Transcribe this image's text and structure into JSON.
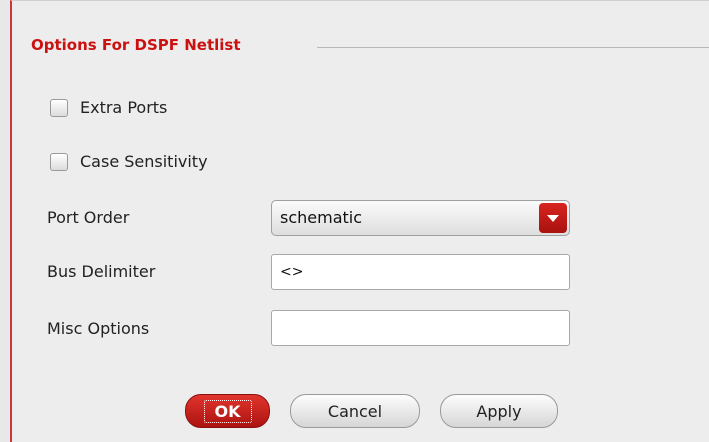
{
  "group": {
    "title": "Options For DSPF Netlist"
  },
  "options": {
    "extra_ports": {
      "label": "Extra Ports",
      "checked": false
    },
    "case_sensitivity": {
      "label": "Case Sensitivity",
      "checked": false
    }
  },
  "fields": {
    "port_order": {
      "label": "Port Order",
      "value": "schematic"
    },
    "bus_delimiter": {
      "label": "Bus Delimiter",
      "value": "<>"
    },
    "misc_options": {
      "label": "Misc Options",
      "value": ""
    }
  },
  "buttons": {
    "ok": "OK",
    "cancel": "Cancel",
    "apply": "Apply"
  },
  "colors": {
    "accent": "#cc1111",
    "primary_button": "#c41d18"
  }
}
